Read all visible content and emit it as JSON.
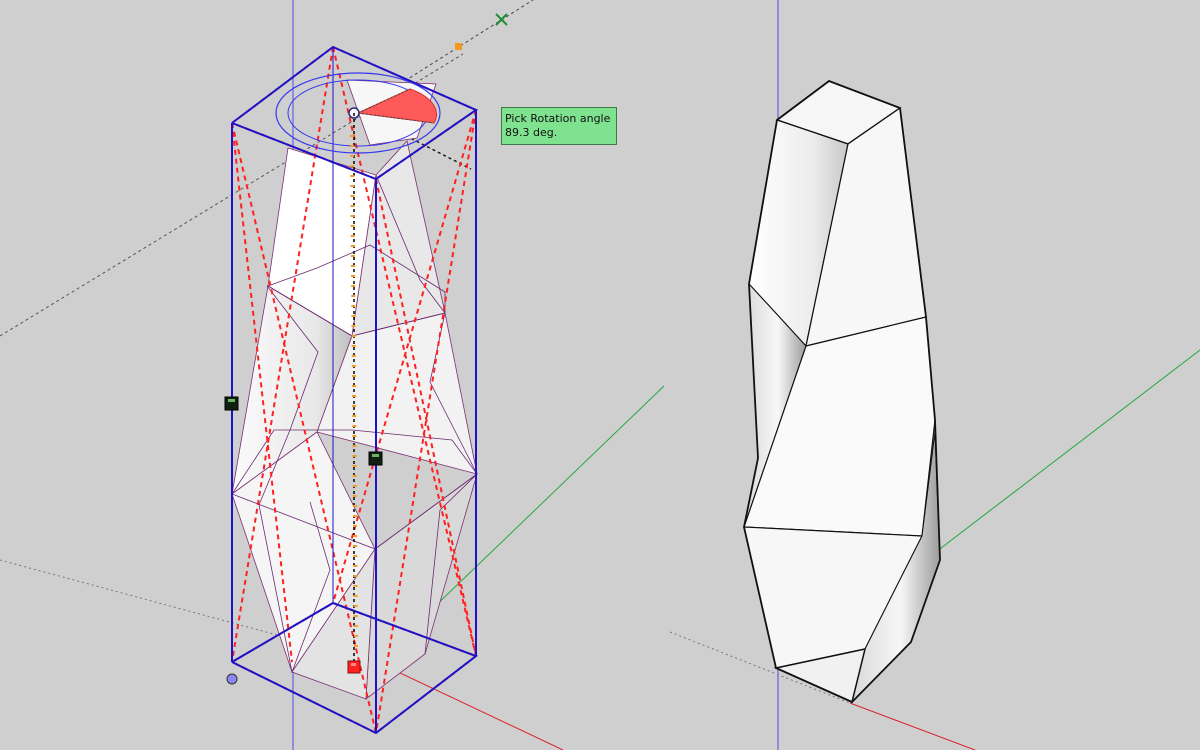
{
  "tooltip": {
    "title": "Pick Rotation angle",
    "value": "89.3 deg."
  },
  "colors": {
    "background": "#cfcfcf",
    "selection_box": "#1d12c8",
    "rotation_preview": "#ff2020",
    "protractor": "#ff5a5a",
    "handle": "#f59a25",
    "tooltip_bg": "#7fe28e",
    "axis_red": "#d8262e",
    "axis_green": "#24a83d",
    "axis_blue": "#4d4de8"
  },
  "scene": {
    "left_object": "twisted-faceted-column-selected",
    "right_object": "twisted-faceted-column-result",
    "active_tool": "rotate"
  }
}
